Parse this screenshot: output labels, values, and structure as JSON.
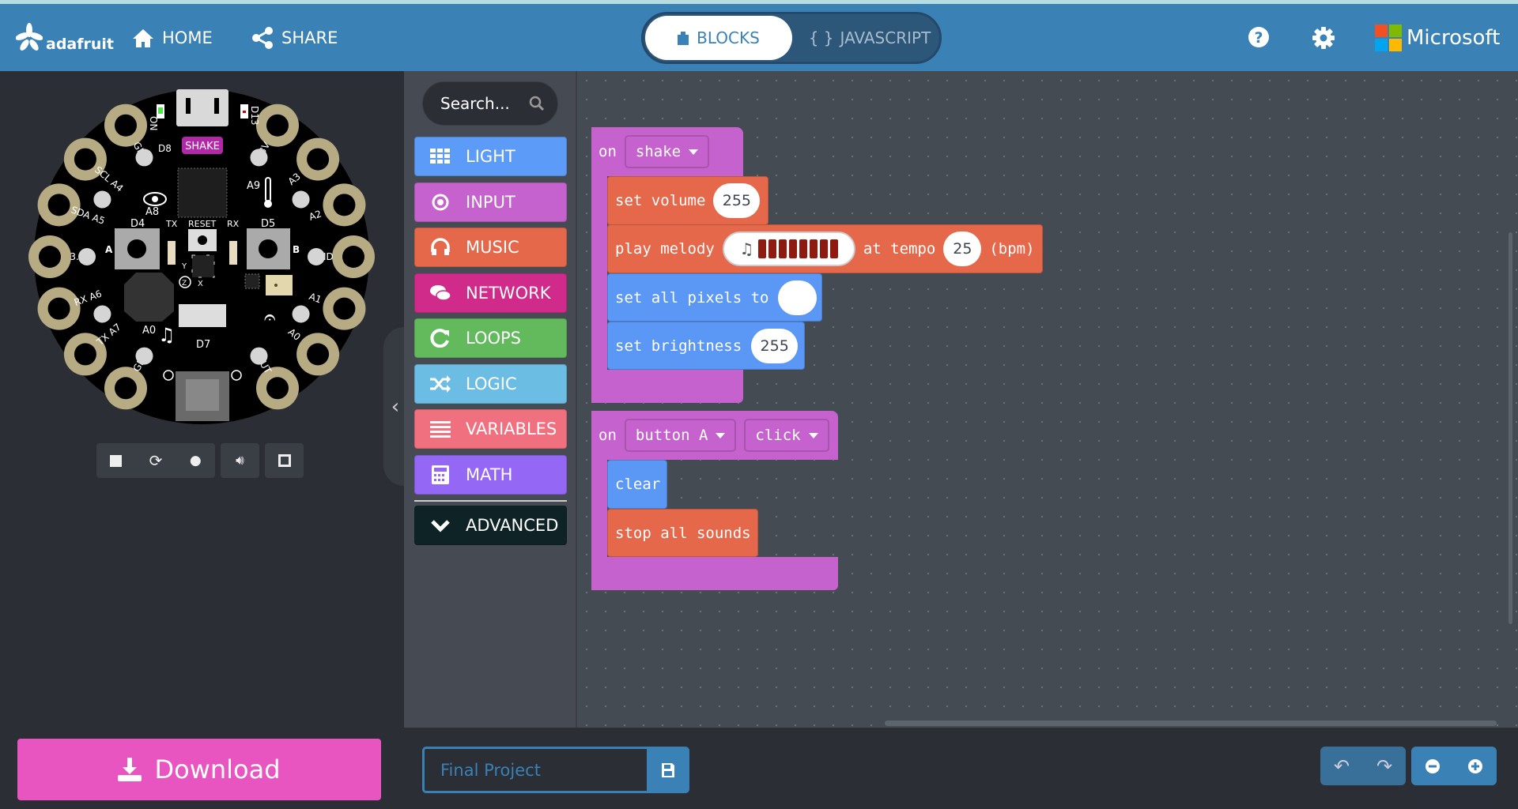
{
  "header": {
    "logo": "adafruit",
    "home": "HOME",
    "share": "SHARE",
    "tabs": [
      {
        "label": "BLOCKS",
        "active": true
      },
      {
        "label": "JAVASCRIPT",
        "active": false
      }
    ],
    "brand": "Microsoft",
    "colors": {
      "bar": "#3a81b5"
    }
  },
  "simulator": {
    "event_badge": "SHAKE",
    "pads_left": [
      "GND",
      "SCL A4",
      "SDA A5",
      "3.3V",
      "RX A6",
      "TX A7",
      "GND"
    ],
    "pads_right": [
      "3.3V",
      "A3",
      "A2",
      "GND",
      "A1",
      "A0",
      "VOUT"
    ],
    "labels": {
      "on": "ON",
      "d13": "D13",
      "d8": "D8",
      "a8": "A8",
      "a9": "A9",
      "d4": "D4",
      "d5": "D5",
      "tx": "TX",
      "rx": "RX",
      "reset": "RESET",
      "a": "A",
      "b": "B",
      "y": "Y",
      "z": "Z",
      "x": "X",
      "a0": "A0",
      "d7": "D7"
    },
    "controls": [
      "stop-icon",
      "restart-icon",
      "slow-motion-icon",
      "mute-icon",
      "fullscreen-icon"
    ]
  },
  "toolbox": {
    "search_placeholder": "Search...",
    "categories": [
      {
        "label": "LIGHT",
        "icon": "grid-icon",
        "color": "#5c9bf7"
      },
      {
        "label": "INPUT",
        "icon": "target-icon",
        "color": "#c662cd"
      },
      {
        "label": "MUSIC",
        "icon": "headphones-icon",
        "color": "#e5684a"
      },
      {
        "label": "NETWORK",
        "icon": "chat-icon",
        "color": "#d02a8a"
      },
      {
        "label": "LOOPS",
        "icon": "refresh-icon",
        "color": "#62ba5d"
      },
      {
        "label": "LOGIC",
        "icon": "shuffle-icon",
        "color": "#6bbde3"
      },
      {
        "label": "VARIABLES",
        "icon": "list-icon",
        "color": "#f0707f"
      },
      {
        "label": "MATH",
        "icon": "calculator-icon",
        "color": "#9468f5"
      }
    ],
    "advanced": {
      "label": "ADVANCED",
      "color": "#0e2326"
    }
  },
  "blocks": {
    "shake_event": {
      "on": "on",
      "event": "shake",
      "color": "#c662cd"
    },
    "set_volume": {
      "label": "set volume",
      "value": "255",
      "color": "#e5684a"
    },
    "play_melody": {
      "label": "play melody",
      "at_tempo": "at tempo",
      "tempo": "25",
      "unit": "(bpm)",
      "note_bars": 8,
      "bar_color": "#8e1a10"
    },
    "set_all_pixels": {
      "label": "set all pixels to",
      "color_value": "#ffffff",
      "color": "#5b97f5"
    },
    "set_brightness": {
      "label": "set brightness",
      "value": "255"
    },
    "button_event": {
      "on": "on",
      "button": "button A",
      "action": "click"
    },
    "clear": {
      "label": "clear"
    },
    "stop_sounds": {
      "label": "stop all sounds"
    }
  },
  "footer": {
    "download": "Download",
    "download_color": "#e855c0",
    "project_name": "Final Project"
  }
}
